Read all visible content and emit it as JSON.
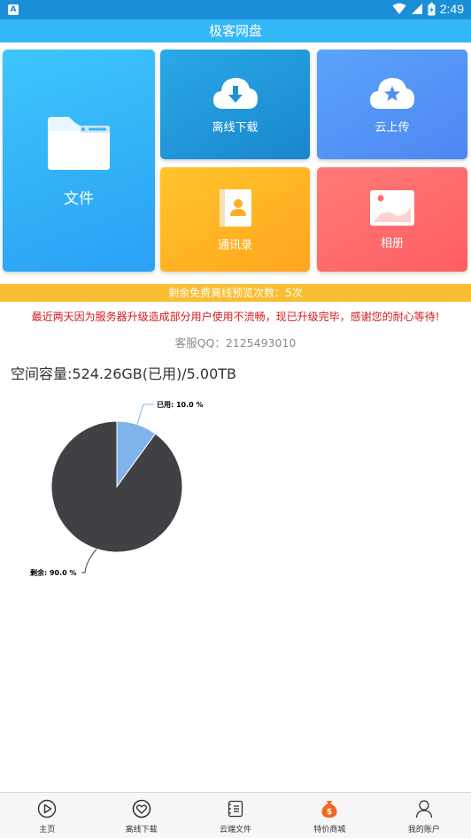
{
  "status_bar": {
    "notification": "A",
    "time": "2:49"
  },
  "app": {
    "title": "极客网盘"
  },
  "tiles": {
    "files": {
      "label": "文件",
      "icon": "folder-icon"
    },
    "offline_download": {
      "label": "离线下载",
      "icon": "cloud-download-icon"
    },
    "cloud_upload": {
      "label": "云上传",
      "icon": "cloud-star-icon"
    },
    "contacts": {
      "label": "通讯录",
      "icon": "contacts-book-icon"
    },
    "album": {
      "label": "相册",
      "icon": "photo-icon"
    }
  },
  "notice_bar": "剩余免费离线预览次数：5次",
  "announcement": "最近两天因为服务器升级造成部分用户使用不流畅，现已升级完毕，感谢您的耐心等待!",
  "customer_service": "客服QQ：2125493010",
  "capacity_text": "空间容量:524.26GB(已用)/5.00TB",
  "chart_data": {
    "type": "pie",
    "slices": [
      {
        "label": "已用",
        "value": 10.0,
        "color": "#7fb4ec"
      },
      {
        "label": "剩余",
        "value": 90.0,
        "color": "#404045"
      }
    ],
    "data_labels": [
      "已用: 10.0 %",
      "剩余: 90.0 %"
    ]
  },
  "bottom_nav": [
    {
      "label": "主页",
      "icon": "play-circle-icon",
      "active": false
    },
    {
      "label": "离线下载",
      "icon": "heart-circle-icon",
      "active": false
    },
    {
      "label": "云端文件",
      "icon": "document-list-icon",
      "active": false
    },
    {
      "label": "特价商城",
      "icon": "money-bag-icon",
      "active": true
    },
    {
      "label": "我的账户",
      "icon": "user-icon",
      "active": false
    }
  ]
}
